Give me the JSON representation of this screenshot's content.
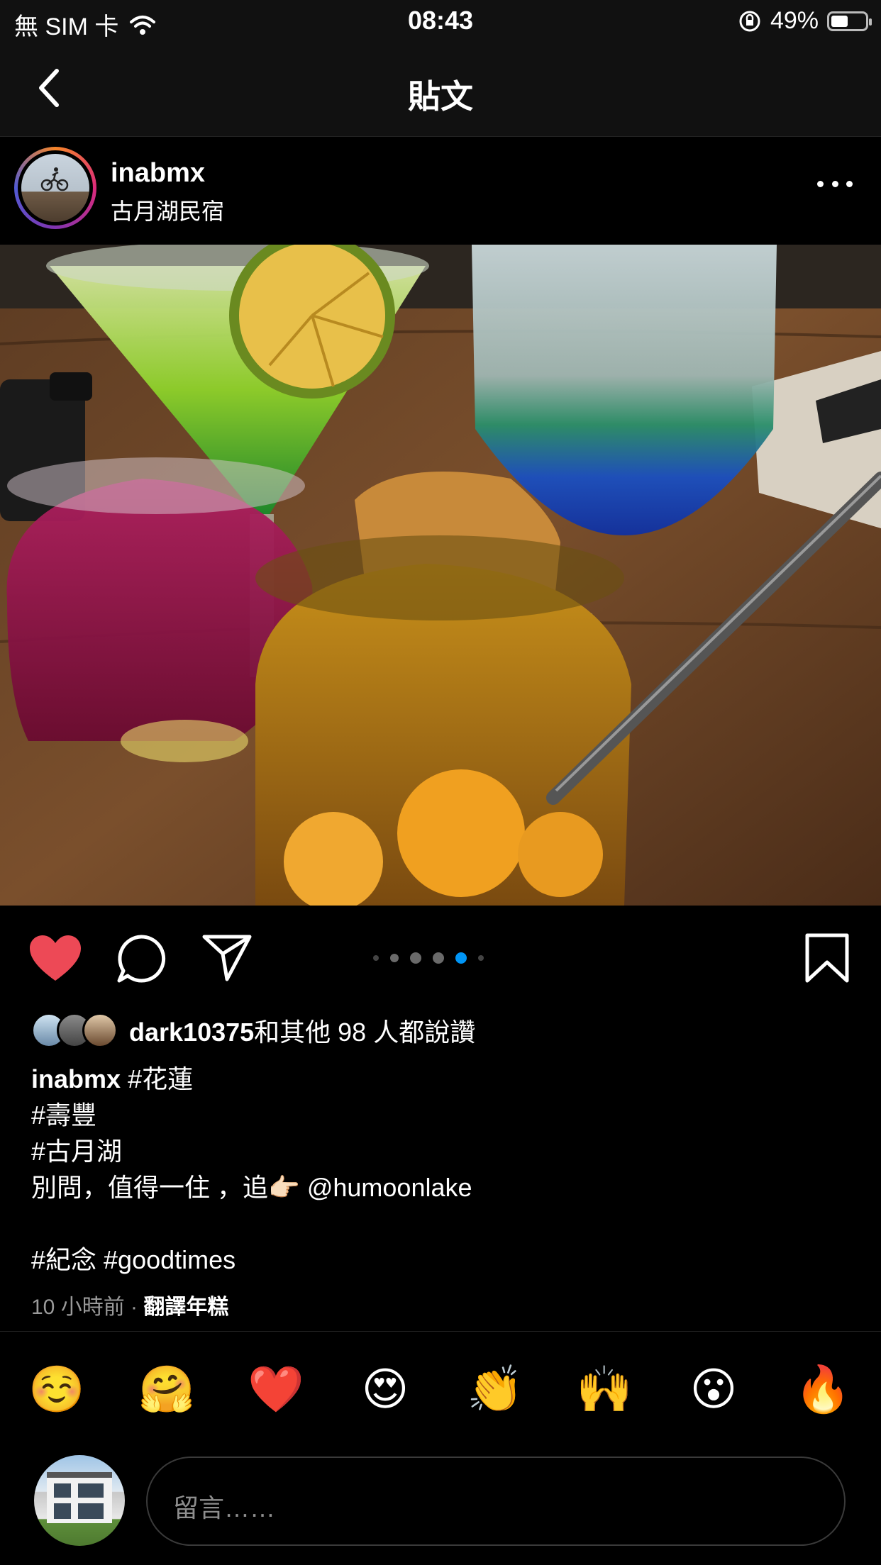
{
  "status_bar": {
    "carrier": "無 SIM 卡",
    "time": "08:43",
    "battery": "49%",
    "battery_level": 0.49
  },
  "nav": {
    "title": "貼文"
  },
  "post": {
    "username": "inabmx",
    "location": "古月湖民宿",
    "carousel": {
      "count": 6,
      "active_index": 4
    }
  },
  "likes": {
    "user": "dark10375",
    "rest": "和其他 98 人都說讚"
  },
  "caption": {
    "username": "inabmx",
    "lines": [
      "#花蓮",
      "#壽豐",
      "#古月湖",
      "別問，值得一住 ，追👉🏻 @humoonlake",
      "",
      "#紀念 #goodtimes"
    ]
  },
  "meta": {
    "time_ago": "10 小時前",
    "separator": " · ",
    "translate": "翻譯年糕"
  },
  "reactions": [
    "☺️",
    "🤗",
    "❤️",
    "😍",
    "👏",
    "🙌",
    "😮",
    "🔥"
  ],
  "comment": {
    "placeholder": "留言……"
  },
  "colors": {
    "like_red": "#ed4956",
    "carousel_active": "#0095f6"
  }
}
